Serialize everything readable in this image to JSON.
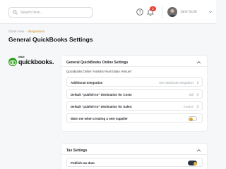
{
  "search": {
    "placeholder": "Search here..."
  },
  "header": {
    "user_name": "Jane Scott",
    "notification_count": "2"
  },
  "breadcrumb": {
    "parent": "Client Area",
    "current": "Integrations"
  },
  "page": {
    "title": "General QuickBooks Settings"
  },
  "logo": {
    "intuit": "intuit",
    "wordmark": "quickbooks."
  },
  "general_section": {
    "title": "General QuickBooks Online Settings",
    "subtitle": "QuickBooks Online “Hatluk’s Real Estate Venture”",
    "rows": [
      {
        "label": "Additional Integration",
        "value": "Set Additional Integration"
      },
      {
        "label": "Default “publish to” destination for Costs",
        "value": "Bill"
      },
      {
        "label": "Default “publish to” destination for Sales:",
        "value": "Invoice"
      }
    ],
    "toggle_row": {
      "label": "Warn me when creating a new supplier",
      "on": false
    }
  },
  "tax_section": {
    "title": "Tax Settings",
    "toggle_row": {
      "label": "Publish tax data",
      "on": true
    }
  },
  "colors": {
    "accent": "#d08a1f",
    "toggle_knob": "#e6b23a",
    "brand_green": "#2ca01c",
    "badge_red": "#e0463c"
  }
}
